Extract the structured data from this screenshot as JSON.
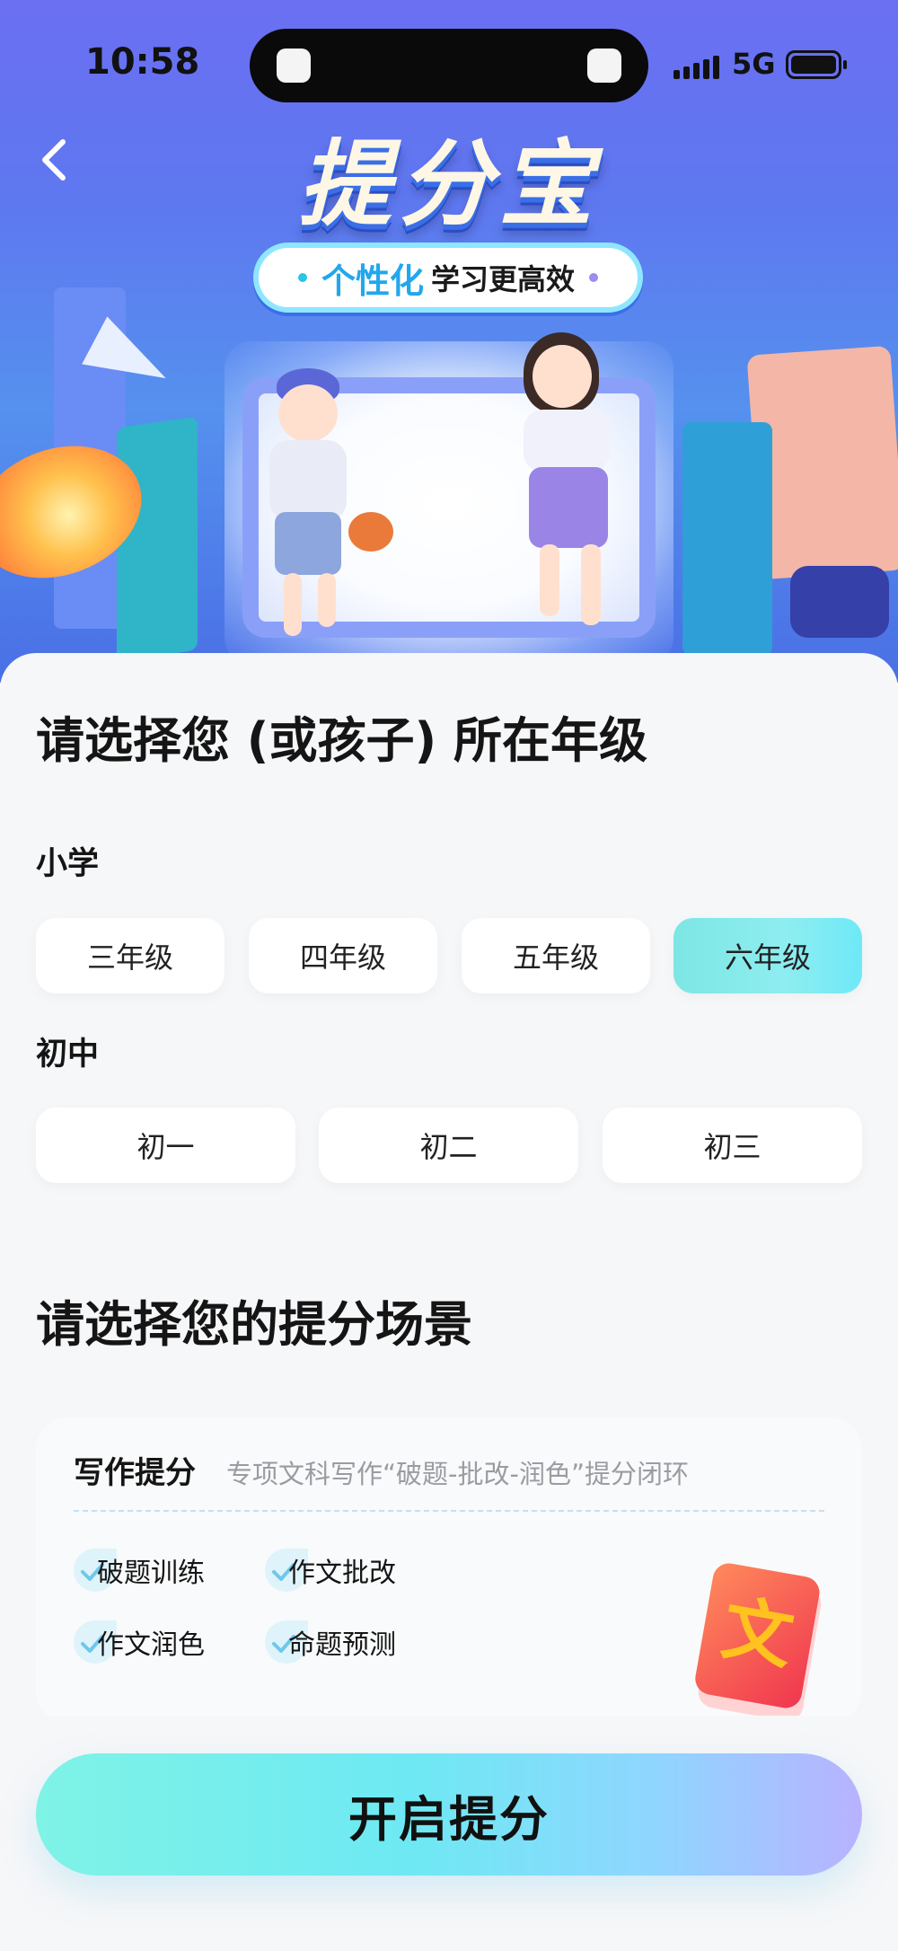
{
  "status_bar": {
    "time": "10:58",
    "network": "5G"
  },
  "hero": {
    "title": "提分宝",
    "slogan_highlight": "个性化",
    "slogan_text": "学习更高效"
  },
  "grade_section": {
    "heading": "请选择您 (或孩子) 所在年级",
    "primary": {
      "label": "小学",
      "grades": [
        "三年级",
        "四年级",
        "五年级",
        "六年级"
      ],
      "selected": "六年级"
    },
    "junior": {
      "label": "初中",
      "grades": [
        "初一",
        "初二",
        "初三"
      ]
    }
  },
  "scene_section": {
    "heading": "请选择您的提分场景",
    "card": {
      "title": "写作提分",
      "description": "专项文科写作“破题-批改-润色”提分闭环",
      "tags": [
        "破题训练",
        "作文批改",
        "作文润色",
        "命题预测"
      ],
      "book_glyph": "文"
    }
  },
  "cta": {
    "label": "开启提分"
  },
  "colors": {
    "selected_grade": "#7de6e4",
    "cta_start": "#7ff3e6",
    "cta_end": "#b9b2ff",
    "hero_bg": "#6b6ff2"
  }
}
